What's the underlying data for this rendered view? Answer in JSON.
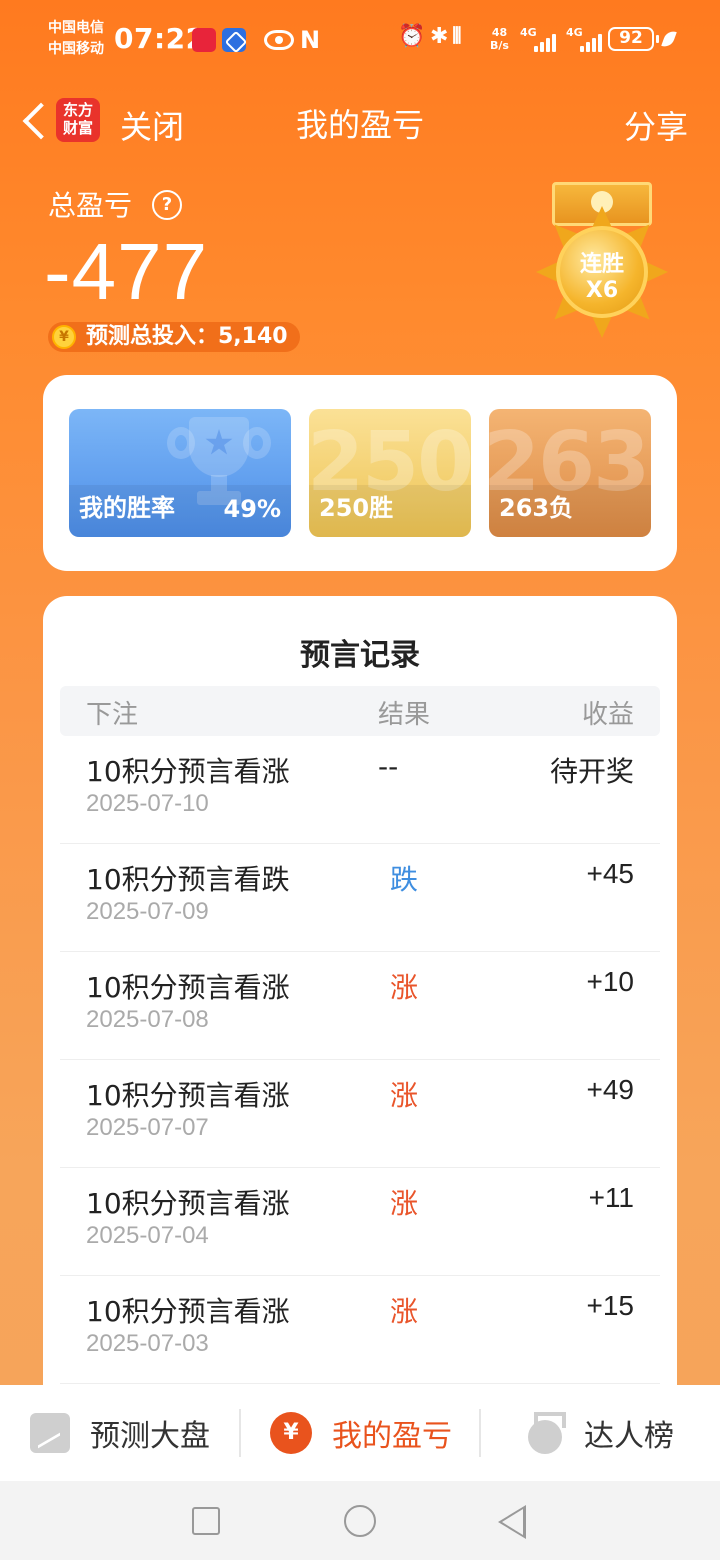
{
  "status_bar": {
    "carrier1": "中国电信",
    "carrier2": "中国移动",
    "time": "07:22",
    "nfc": "N",
    "alarm_icon": "⏰",
    "bt_icon": "✱",
    "vibrate_icon": "⦀",
    "net_speed_top": "48",
    "net_speed_bottom": "B/s",
    "signal1_label": "4G",
    "signal2_label": "4G",
    "battery": "92"
  },
  "header": {
    "logo_text": "东方财富",
    "close_label": "关闭",
    "title": "我的盈亏",
    "share_label": "分享"
  },
  "summary": {
    "total_label": "总盈亏",
    "help_icon": "?",
    "total_value": "-477",
    "invest_coin": "¥",
    "invest_text": "预测总投入：5,140",
    "medal_line1": "连胜",
    "medal_line2": "X6"
  },
  "stats": {
    "win_rate_label": "我的胜率",
    "win_rate_value": "49%",
    "wins_big": "250",
    "wins_label": "250胜",
    "losses_big": "263",
    "losses_label": "263负"
  },
  "records": {
    "title": "预言记录",
    "headers": [
      "下注",
      "结果",
      "收益"
    ],
    "rows": [
      {
        "bet": "10积分预言看涨",
        "date": "2025-07-10",
        "result": "--",
        "earn": "待开奖"
      },
      {
        "bet": "10积分预言看跌",
        "date": "2025-07-09",
        "result": "跌",
        "earn": "+45"
      },
      {
        "bet": "10积分预言看涨",
        "date": "2025-07-08",
        "result": "涨",
        "earn": "+10"
      },
      {
        "bet": "10积分预言看涨",
        "date": "2025-07-07",
        "result": "涨",
        "earn": "+49"
      },
      {
        "bet": "10积分预言看涨",
        "date": "2025-07-04",
        "result": "涨",
        "earn": "+11"
      },
      {
        "bet": "10积分预言看涨",
        "date": "2025-07-03",
        "result": "涨",
        "earn": "+15"
      }
    ]
  },
  "colors": {
    "rise": "#e9552b",
    "fall": "#3f8ee0",
    "neutral": "#222222",
    "tab_active": "#e9531d",
    "tab_inactive": "#333333"
  },
  "tabs": [
    {
      "label": "预测大盘",
      "icon": "chart-icon"
    },
    {
      "label": "我的盈亏",
      "icon": "yen-icon",
      "yen": "¥"
    },
    {
      "label": "达人榜",
      "icon": "medal-icon"
    }
  ]
}
